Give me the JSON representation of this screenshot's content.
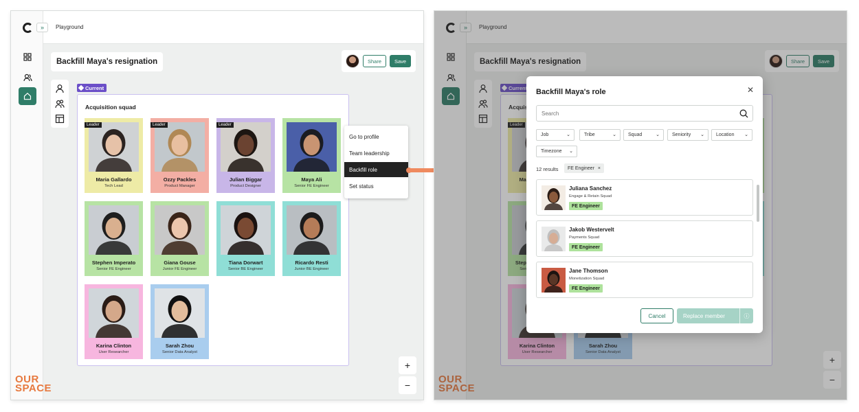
{
  "app": {
    "breadcrumb": "Playground",
    "brand_line1": "OUR",
    "brand_line2": "SPACE",
    "expand_glyph": "»"
  },
  "scenario": {
    "title": "Backfill Maya's resignation",
    "share_label": "Share",
    "save_label": "Save",
    "current_label": "Current",
    "squad_name": "Acquisition squad",
    "leader_label": "Leader"
  },
  "members": [
    {
      "name": "Maria Gallardo",
      "role": "Tech Lead",
      "leader": true,
      "color": "#eeeba6"
    },
    {
      "name": "Ozzy Packles",
      "role": "Product Manager",
      "leader": true,
      "color": "#f3aea4"
    },
    {
      "name": "Julian Biggar",
      "role": "Product Designer",
      "leader": true,
      "color": "#c8b6e8"
    },
    {
      "name": "Maya Ali",
      "role": "Senior FE Engineer",
      "leader": false,
      "color": "#b7e3a4"
    },
    {
      "name": "Stephen Imperato",
      "role": "Senior FE Engineer",
      "leader": false,
      "color": "#b7e3a4"
    },
    {
      "name": "Giana Gouse",
      "role": "Junior FE Engineer",
      "leader": false,
      "color": "#b7e3a4"
    },
    {
      "name": "Tiana Dorwart",
      "role": "Senior BE Engineer",
      "leader": false,
      "color": "#8fded6"
    },
    {
      "name": "Ricardo Resti",
      "role": "Junior BE Engineer",
      "leader": false,
      "color": "#8fded6"
    },
    {
      "name": "Karina Clinton",
      "role": "User Researcher",
      "leader": false,
      "color": "#f7b6df"
    },
    {
      "name": "Sarah Zhou",
      "role": "Senior Data Analyst",
      "leader": false,
      "color": "#a9cdee"
    }
  ],
  "context_menu": [
    {
      "label": "Go to profile"
    },
    {
      "label": "Team leadership"
    },
    {
      "label": "Backfill role",
      "highlighted": true
    },
    {
      "label": "Set status"
    }
  ],
  "zoom": {
    "in": "+",
    "out": "−"
  },
  "modal": {
    "title": "Backfill Maya's role",
    "close_glyph": "✕",
    "search_placeholder": "Search",
    "filters": [
      "Job",
      "Tribe",
      "Squad",
      "Seniority",
      "Location",
      "Timezone"
    ],
    "results_count": "12 results",
    "active_filter": "FE Engineer",
    "chip_remove": "×",
    "candidates": [
      {
        "name": "Juliana Sanchez",
        "squad": "Engage & Retain Squad",
        "tag": "FE Engineer"
      },
      {
        "name": "Jakob Westervelt",
        "squad": "Payments Squad",
        "tag": "FE Engineer"
      },
      {
        "name": "Jane Thomson",
        "squad": "Monetization Squad",
        "tag": "FE Engineer"
      }
    ],
    "cancel_label": "Cancel",
    "replace_label": "Replace member",
    "replace_info_glyph": "ⓘ"
  },
  "colors": {
    "accent": "#2f7d68",
    "brand": "#e7793f",
    "current_tag": "#6b4fc8",
    "connector_arrow": "#ef8a5f",
    "fe_tag": "#aee29c"
  },
  "icons": [
    "grid-icon",
    "people-icon",
    "home-icon",
    "person-icon",
    "group-icon",
    "layout-icon",
    "search-icon",
    "close-icon",
    "chevron-down-icon",
    "info-icon"
  ]
}
